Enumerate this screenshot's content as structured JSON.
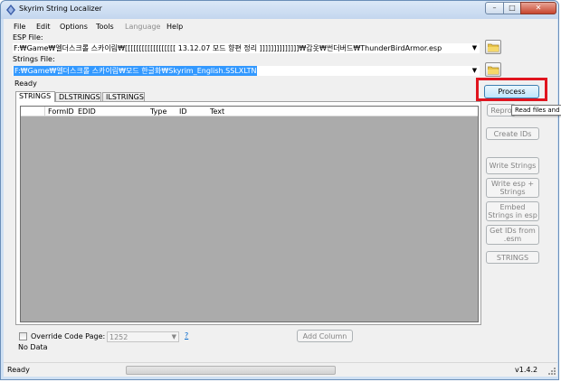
{
  "window": {
    "title": "Skyrim String Localizer",
    "controls": {
      "minimize": "–",
      "maximize": "□",
      "close": "✕"
    }
  },
  "menu": {
    "items": [
      "File",
      "Edit",
      "Options",
      "Tools",
      "Language",
      "Help"
    ],
    "disabled": [
      "Language"
    ]
  },
  "esp": {
    "label": "ESP File:",
    "value": "F:₩Game₩엘더스크롤 스카이림₩[[[[[[[[[[[[[[[[[[ 13.12.07 모드 향편 정리 ]]]]]]]]]]]]]]₩갑옷₩썬더버드₩ThunderBirdArmor.esp"
  },
  "strings": {
    "label": "Strings File:",
    "value": "F:₩Game₩엘더스크롤 스카이림₩모드 한글화₩Skyrim_English.SSLXLTN"
  },
  "status_top": "Ready",
  "tabs": [
    "STRINGS",
    "DLSTRINGS",
    "ILSTRINGS"
  ],
  "grid": {
    "columns": [
      "FormID",
      "EDID",
      "Type",
      "ID",
      "Text"
    ]
  },
  "options": {
    "override_label": "Override Code Page:",
    "code_page": "1252",
    "help": "?",
    "no_data": "No Data",
    "add_column": "Add Column"
  },
  "buttons": {
    "process": "Process",
    "reprocess": "Repro",
    "create_ids": "Create IDs",
    "write_strings": "Write Strings",
    "write_esp": "Write esp + Strings",
    "embed": "Embed Strings in esp",
    "get_ids": "Get IDs from .esm",
    "strings": "STRINGS"
  },
  "tooltip": "Read files and",
  "statusbar": {
    "text": "Ready",
    "version": "v1.4.2"
  },
  "colors": {
    "highlight": "#e0141e",
    "selection": "#3399ff",
    "grid_bg": "#ababab"
  }
}
